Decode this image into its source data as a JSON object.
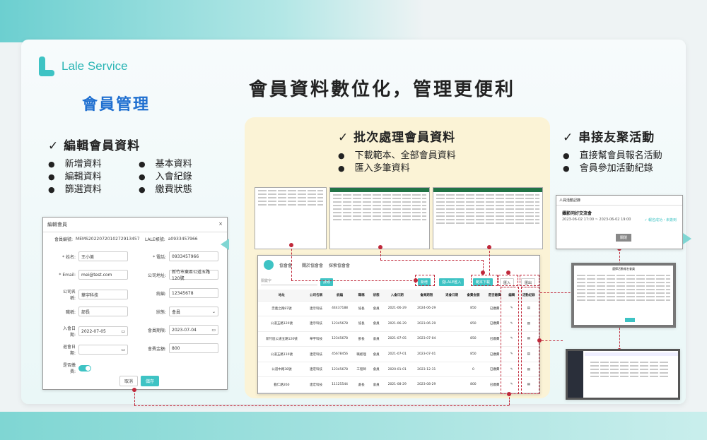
{
  "brand": {
    "name": "Lale Service",
    "accent": "#3ec3c4",
    "highlight": "#c0283a"
  },
  "main_title": "會員資料數位化，管理更便利",
  "page_subtitle": "會員管理",
  "sections": {
    "edit": {
      "heading": "✓ 編輯會員資料",
      "col1": [
        "新增資料",
        "編輯資料",
        "篩選資料"
      ],
      "col2": [
        "基本資料",
        "入會紀錄",
        "繳費狀態"
      ]
    },
    "batch": {
      "heading": "✓ 批次處理會員資料",
      "items": [
        "下載範本、全部會員資料",
        "匯入多筆資料"
      ]
    },
    "events": {
      "heading": "✓ 串接友聚活動",
      "items": [
        "直接幫會員報名活動",
        "會員參加活動紀錄"
      ]
    }
  },
  "edit_form": {
    "title": "編輯會員",
    "close": "×",
    "member_no_label": "會員編號:",
    "member_no": "MEMS2022072010272913457",
    "line_label": "LALE帳號:",
    "line_value": "a0933457966",
    "name_label": "* 姓名:",
    "name_value": "王小美",
    "phone_label": "* 電話:",
    "phone_value": "0933457966",
    "email_label": "* Email:",
    "email_value": "mei@test.com",
    "company_addr_label": "公司地址:",
    "company_addr_value": "新竹市東區公道五路120號",
    "company_label": "公司名稱:",
    "company_value": "華宇科技",
    "tax_label": "統編:",
    "tax_value": "12345678",
    "title_label": "職稱:",
    "title_value": "部長",
    "status_label": "狀態:",
    "status_value": "會員",
    "join_label": "入會日期:",
    "join_value": "2022-07-05",
    "expire_label": "會員期限:",
    "expire_value": "2023-07-04",
    "quit_label": "退會日期:",
    "fee_label": "會費金額:",
    "fee_value": "800",
    "paid_label": "是否繳費:",
    "cancel": "取消",
    "save": "儲存"
  },
  "member_list": {
    "badge": "會",
    "title": "協會會",
    "tabs": [
      "關於協會會",
      "探索協會會"
    ],
    "search_placeholder": "關鍵字",
    "search_button": "搜尋",
    "toolbar": [
      "新增",
      "從LALE匯入",
      "範本下載",
      "匯入",
      "匯出"
    ],
    "columns": [
      "地址",
      "公司名稱",
      "統編",
      "職稱",
      "狀態",
      "入會日期",
      "會員期限",
      "退會日期",
      "會費金額",
      "是否繳費",
      "編輯",
      "活動紀錄"
    ],
    "rows": [
      [
        "忠義之路87號",
        "連示科技",
        "44437188",
        "協長",
        "會員",
        "2021-06-29",
        "2024-06-29",
        "",
        "850",
        "已繳費"
      ],
      [
        "公道五路120號",
        "連示科技",
        "12345678",
        "協長",
        "會員",
        "2021-06-29",
        "2023-06-29",
        "",
        "850",
        "已繳費"
      ],
      [
        "新竹區公道五路120號",
        "華宇科技",
        "12345678",
        "部長",
        "會員",
        "2021-07-05",
        "2023-07-04",
        "",
        "850",
        "已繳費"
      ],
      [
        "公道五路110號",
        "連宏科技",
        "45678456",
        "職經理",
        "會員",
        "2021-07-01",
        "2023-07-01",
        "",
        "850",
        "已繳費"
      ],
      [
        "公道中路38號",
        "連宏科技",
        "12345678",
        "工程師",
        "會員",
        "2020-01-01",
        "2023-12-31",
        "",
        "0",
        "已繳費"
      ],
      [
        "勤仁路260",
        "連宏科技",
        "11125544",
        "處長",
        "會員",
        "2021-08-29",
        "2023-08-29",
        "",
        "800",
        "已繳費"
      ]
    ]
  },
  "event_window": {
    "title": "人員活動記錄",
    "event_name": "攝影同好交流會",
    "event_time": "2023-06-02 17:00 ~ 2023-06-02 19:00",
    "event_status": "✓ 報名成功・未簽到",
    "close": "關閉"
  },
  "signup_window": {
    "title": "選擇活動報名會員"
  }
}
